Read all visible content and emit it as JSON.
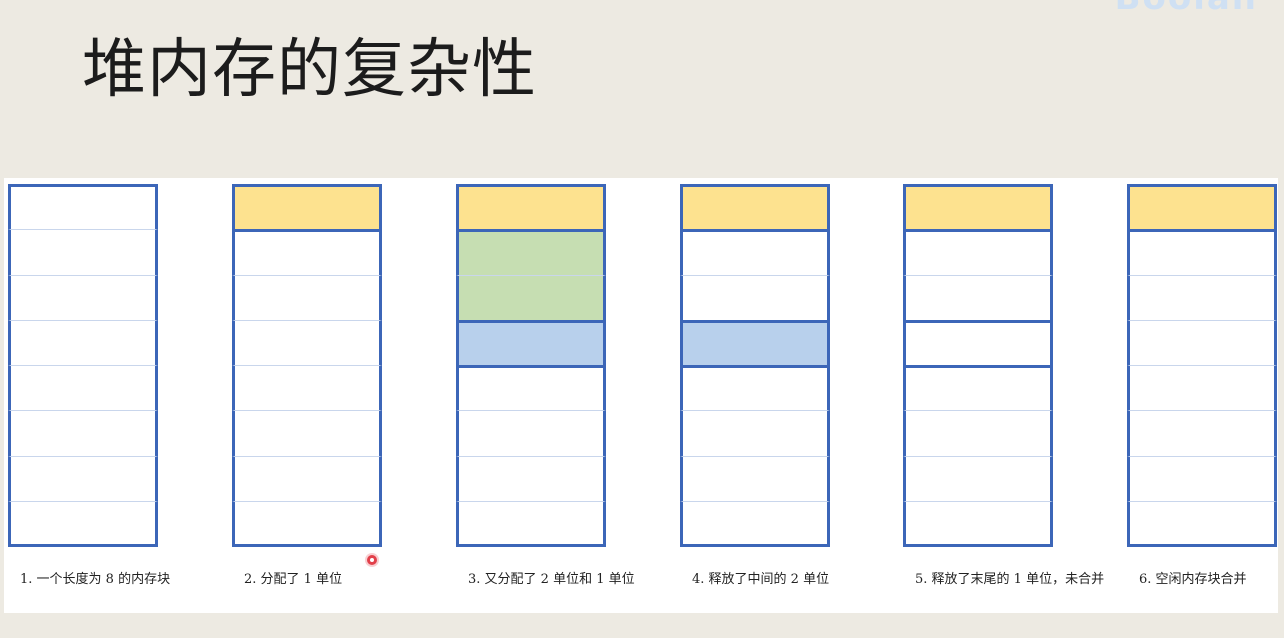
{
  "slide": {
    "title": "堆内存的复杂性",
    "logo_text": "Boolan"
  },
  "colors": {
    "allocated_1": "#fde28f",
    "allocated_2": "#c6deb2",
    "allocated_3": "#b8d0ec",
    "free": "#ffffff",
    "block_border": "#3c66b8",
    "divider": "#c9d6ec"
  },
  "columns": [
    {
      "caption": "1. 一个长度为 8 的内存块",
      "units": [
        {
          "fill": "free",
          "boundary_after": false
        },
        {
          "fill": "free",
          "boundary_after": false
        },
        {
          "fill": "free",
          "boundary_after": false
        },
        {
          "fill": "free",
          "boundary_after": false
        },
        {
          "fill": "free",
          "boundary_after": false
        },
        {
          "fill": "free",
          "boundary_after": false
        },
        {
          "fill": "free",
          "boundary_after": false
        },
        {
          "fill": "free",
          "boundary_after": false
        }
      ]
    },
    {
      "caption": "2. 分配了 1 单位",
      "units": [
        {
          "fill": "allocated_1",
          "boundary_after": true
        },
        {
          "fill": "free",
          "boundary_after": false
        },
        {
          "fill": "free",
          "boundary_after": false
        },
        {
          "fill": "free",
          "boundary_after": false
        },
        {
          "fill": "free",
          "boundary_after": false
        },
        {
          "fill": "free",
          "boundary_after": false
        },
        {
          "fill": "free",
          "boundary_after": false
        },
        {
          "fill": "free",
          "boundary_after": false
        }
      ]
    },
    {
      "caption": "3. 又分配了 2 单位和 1 单位",
      "units": [
        {
          "fill": "allocated_1",
          "boundary_after": true
        },
        {
          "fill": "allocated_2",
          "boundary_after": false
        },
        {
          "fill": "allocated_2",
          "boundary_after": true
        },
        {
          "fill": "allocated_3",
          "boundary_after": true
        },
        {
          "fill": "free",
          "boundary_after": false
        },
        {
          "fill": "free",
          "boundary_after": false
        },
        {
          "fill": "free",
          "boundary_after": false
        },
        {
          "fill": "free",
          "boundary_after": false
        }
      ]
    },
    {
      "caption": "4. 释放了中间的 2 单位",
      "units": [
        {
          "fill": "allocated_1",
          "boundary_after": true
        },
        {
          "fill": "free",
          "boundary_after": false
        },
        {
          "fill": "free",
          "boundary_after": true
        },
        {
          "fill": "allocated_3",
          "boundary_after": true
        },
        {
          "fill": "free",
          "boundary_after": false
        },
        {
          "fill": "free",
          "boundary_after": false
        },
        {
          "fill": "free",
          "boundary_after": false
        },
        {
          "fill": "free",
          "boundary_after": false
        }
      ]
    },
    {
      "caption": "5. 释放了末尾的 1 单位，未合并",
      "units": [
        {
          "fill": "allocated_1",
          "boundary_after": true
        },
        {
          "fill": "free",
          "boundary_after": false
        },
        {
          "fill": "free",
          "boundary_after": true
        },
        {
          "fill": "free",
          "boundary_after": true
        },
        {
          "fill": "free",
          "boundary_after": false
        },
        {
          "fill": "free",
          "boundary_after": false
        },
        {
          "fill": "free",
          "boundary_after": false
        },
        {
          "fill": "free",
          "boundary_after": false
        }
      ]
    },
    {
      "caption": "6. 空闲内存块合并",
      "units": [
        {
          "fill": "allocated_1",
          "boundary_after": true
        },
        {
          "fill": "free",
          "boundary_after": false
        },
        {
          "fill": "free",
          "boundary_after": false
        },
        {
          "fill": "free",
          "boundary_after": false
        },
        {
          "fill": "free",
          "boundary_after": false
        },
        {
          "fill": "free",
          "boundary_after": false
        },
        {
          "fill": "free",
          "boundary_after": false
        },
        {
          "fill": "free",
          "boundary_after": false
        }
      ]
    }
  ]
}
